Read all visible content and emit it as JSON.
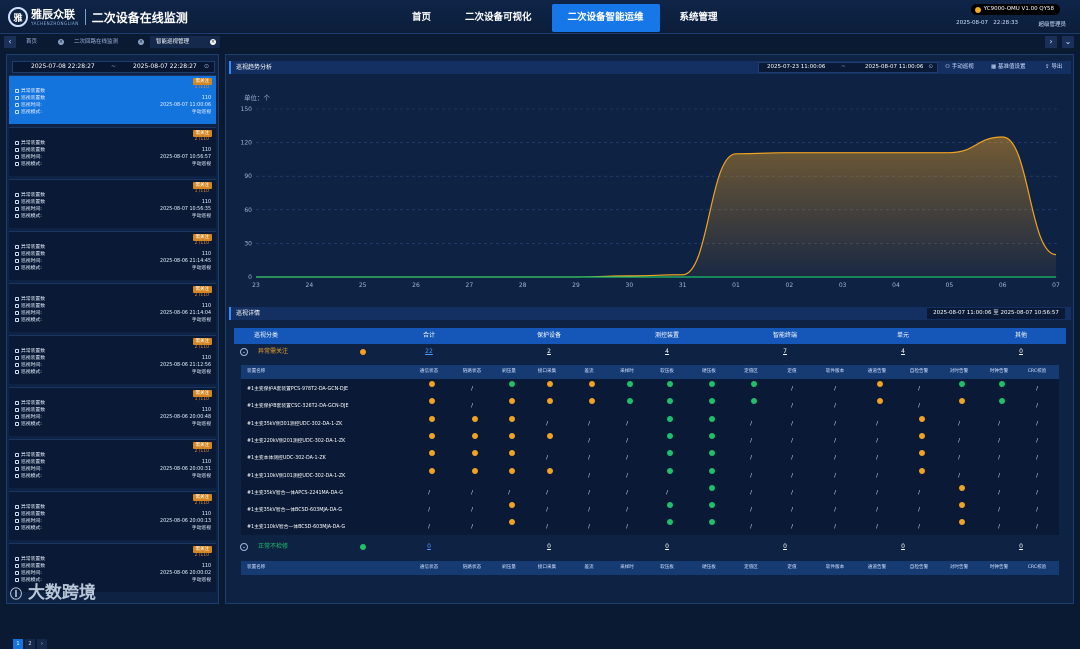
{
  "header": {
    "logo_text": "雅辰众联",
    "logo_sub": "YACHENZHONGLIAN",
    "title": "二次设备在线监测",
    "nav": [
      "首页",
      "二次设备可视化",
      "二次设备智能运维",
      "系统管理"
    ],
    "version": "YC9000-OMU V1.00 QY58",
    "date": "2025-08-07",
    "time": "22:28:33",
    "user": "超级管理员"
  },
  "tabs": [
    "首页",
    "二次回路在线监测",
    "智能巡视管理"
  ],
  "left": {
    "date_from": "2025-07-08 22:28:27",
    "date_to": "2025-08-07 22:28:27",
    "tilde": "~",
    "labels": {
      "a": "异常装置数",
      "b": "巡视装置数",
      "c": "巡视时间:",
      "d": "巡视模式:"
    },
    "cards": [
      {
        "tag": "需关注",
        "stat": "1 /110",
        "total": "110",
        "time": "2025-08-07 11:00:06",
        "mode": "手动巡视"
      },
      {
        "tag": "需关注",
        "stat": "2 /110",
        "total": "110",
        "time": "2025-08-07 10:56:57",
        "mode": "手动巡视"
      },
      {
        "tag": "需关注",
        "stat": "1 /110",
        "total": "110",
        "time": "2025-08-07 10:56:35",
        "mode": "手动巡视"
      },
      {
        "tag": "需关注",
        "stat": "2 /110",
        "total": "110",
        "time": "2025-08-06 21:14:45",
        "mode": "手动巡视"
      },
      {
        "tag": "需关注",
        "stat": "2 /110",
        "total": "110",
        "time": "2025-08-06 21:14:04",
        "mode": "手动巡视"
      },
      {
        "tag": "需关注",
        "stat": "2 /110",
        "total": "110",
        "time": "2025-08-06 21:12:56",
        "mode": "手动巡视"
      },
      {
        "tag": "需关注",
        "stat": "1 /110",
        "total": "110",
        "time": "2025-08-06 20:00:48",
        "mode": "手动巡视"
      },
      {
        "tag": "需关注",
        "stat": "2 /110",
        "total": "110",
        "time": "2025-08-06 20:00:31",
        "mode": "手动巡视"
      },
      {
        "tag": "需关注",
        "stat": "2 /110",
        "total": "110",
        "time": "2025-08-06 20:00:13",
        "mode": "手动巡视"
      },
      {
        "tag": "需关注",
        "stat": "2 /110",
        "total": "110",
        "time": "2025-08-06 20:00:02",
        "mode": "手动巡视"
      }
    ],
    "pager": [
      "1",
      "2",
      "›"
    ]
  },
  "trend": {
    "title": "巡视趋势分析",
    "from": "2025-07-23 11:00:06",
    "to": "2025-08-07 11:00:06",
    "buttons": [
      "手动巡视",
      "基准值设置",
      "导出"
    ],
    "unit": "单位：个"
  },
  "chart_data": {
    "type": "area",
    "x": [
      "23",
      "24",
      "25",
      "26",
      "27",
      "28",
      "29",
      "30",
      "31",
      "01",
      "02",
      "03",
      "04",
      "05",
      "06",
      "07"
    ],
    "ylim": [
      0,
      150
    ],
    "yticks": [
      0,
      30,
      60,
      90,
      120,
      150
    ],
    "series": [
      {
        "values": [
          0,
          0,
          0,
          0,
          0,
          0,
          0,
          1,
          2,
          110,
          111,
          111,
          111,
          111,
          125,
          20
        ],
        "color": "#f0a322"
      },
      {
        "values": [
          0,
          0,
          0,
          0,
          0,
          0,
          0,
          0,
          0,
          0,
          0,
          0,
          0,
          0,
          0,
          0
        ],
        "color": "#1fc06a"
      }
    ]
  },
  "detail": {
    "title": "巡视详情",
    "range": "2025-08-07 11:00:06 至 2025-08-07 10:56:57",
    "headers": [
      "巡视分类",
      "合计",
      "保护设备",
      "测控装置",
      "智能终端",
      "单元",
      "其他"
    ],
    "groups": [
      {
        "label": "异常需关注",
        "vals": [
          "22",
          "2",
          "4",
          "7",
          "4",
          "0"
        ],
        "color": "#f0a322"
      },
      {
        "label": "正常不检修",
        "vals": [
          "0",
          "0",
          "0",
          "0",
          "0",
          "0"
        ],
        "color": "#1fc06a"
      }
    ],
    "cols": [
      "装置名称",
      "通信状态",
      "链路状态",
      "刷压量",
      "接口采集",
      "差流",
      "采样时",
      "软压板",
      "硬压板",
      "定值区",
      "定值",
      "软件版本",
      "通道告警",
      "自检告警",
      "对时告警",
      "时钟告警",
      "CRC校验"
    ],
    "rows": [
      {
        "name": "#1主变保护A套装置PCS-978T2-DA-GCN-DJE",
        "c": [
          "o",
          "/",
          "g",
          "o",
          "o",
          "g",
          "g",
          "g",
          "g",
          "/",
          "/",
          "o",
          "/",
          "g",
          "g",
          "/"
        ]
      },
      {
        "name": "#1主变保护B套装置CSC-326T2-DA-GCN-DJE",
        "c": [
          "o",
          "/",
          "o",
          "o",
          "o",
          "g",
          "g",
          "g",
          "g",
          "/",
          "/",
          "o",
          "/",
          "o",
          "g",
          "/"
        ]
      },
      {
        "name": "#1主变35kV侧301测控UDC-302-DA-1-ZK",
        "c": [
          "o",
          "o",
          "o",
          "/",
          "/",
          "/",
          "g",
          "g",
          "/",
          "/",
          "/",
          "/",
          "o",
          "/",
          "/",
          "/"
        ]
      },
      {
        "name": "#1主变220kV侧201测控UDC-302-DA-1-ZK",
        "c": [
          "o",
          "o",
          "o",
          "o",
          "/",
          "/",
          "g",
          "g",
          "/",
          "/",
          "/",
          "/",
          "o",
          "/",
          "/",
          "/"
        ]
      },
      {
        "name": "#1主变本体测控UDC-302-DA-1-ZK",
        "c": [
          "o",
          "o",
          "o",
          "/",
          "/",
          "/",
          "g",
          "g",
          "/",
          "/",
          "/",
          "/",
          "o",
          "/",
          "/",
          "/"
        ]
      },
      {
        "name": "#1主变110kV侧101测控UDC-302-DA-1-ZK",
        "c": [
          "o",
          "o",
          "o",
          "o",
          "/",
          "/",
          "g",
          "g",
          "/",
          "/",
          "/",
          "/",
          "o",
          "/",
          "/",
          "/"
        ]
      },
      {
        "name": "#1主变35kV智合一体APCS-2241MA-DA-G",
        "c": [
          "/",
          "/",
          "/",
          "/",
          "/",
          "/",
          "/",
          "g",
          "/",
          "/",
          "/",
          "/",
          "/",
          "o",
          "/",
          "/"
        ]
      },
      {
        "name": "#1主变35kV智合一体BCSD-603MJA-DA-G",
        "c": [
          "/",
          "/",
          "o",
          "/",
          "/",
          "/",
          "g",
          "g",
          "/",
          "/",
          "/",
          "/",
          "/",
          "o",
          "/",
          "/"
        ]
      },
      {
        "name": "#1主变110kV智合一体BCSD-603MJA-DA-G",
        "c": [
          "/",
          "/",
          "o",
          "/",
          "/",
          "/",
          "g",
          "g",
          "/",
          "/",
          "/",
          "/",
          "/",
          "o",
          "/",
          "/"
        ]
      }
    ]
  },
  "watermark": "大数跨境"
}
